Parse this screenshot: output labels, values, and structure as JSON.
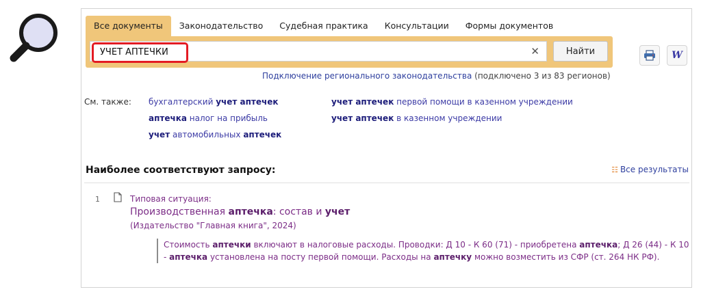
{
  "tabs": [
    "Все документы",
    "Законодательство",
    "Судебная практика",
    "Консультации",
    "Формы документов"
  ],
  "search": {
    "value": "УЧЕТ АПТЕЧКИ",
    "button": "Найти"
  },
  "regional": {
    "link": "Подключение регионального законодательства",
    "count": "(подключено 3 из 83 регионов)"
  },
  "see_also": {
    "label": "См. также:",
    "items": [
      {
        "pre": "бухгалтерский ",
        "bold": "учет аптечек",
        "post": ""
      },
      {
        "pre": "",
        "bold": "аптечка",
        "post": " налог на прибыль"
      },
      {
        "pre": "",
        "bold": "учет",
        "mid": " автомобильных ",
        "bold2": "аптечек"
      },
      {
        "pre": "",
        "bold": "учет аптечек",
        "post": " первой помощи в казенном учреждении"
      },
      {
        "pre": "",
        "bold": "учет аптечек",
        "post": " в казенном учреждении"
      }
    ]
  },
  "results_header": {
    "title": "Наиболее соответствуют запросу:",
    "all_results": "Все результаты"
  },
  "result": {
    "number": "1",
    "kind": "Типовая ситуация:",
    "title_part1": "Производственная ",
    "title_bold1": "аптечка",
    "title_part2": ": состав и ",
    "title_bold2": "учет",
    "source": "(Издательство \"Главная книга\", 2024)",
    "snippet": {
      "s1": "Стоимость ",
      "b1": "аптечки",
      "s2": " включают в налоговые расходы. Проводки: Д 10 - К 60 (71) - приобретена ",
      "b2": "аптечка",
      "s3": "; Д 26 (44) - К 10 - ",
      "b3": "аптечка",
      "s4": " установлена на посту первой помощи. Расходы на ",
      "b4": "аптечку",
      "s5": " можно возместить из СФР (ст. 264 НК РФ)."
    }
  },
  "colors": {
    "accent": "#f0c67a",
    "highlight": "#e31b23",
    "link": "#3b3aa5",
    "result": "#7b2c86"
  },
  "icons": [
    "magnifier-icon",
    "clear-icon",
    "print-icon",
    "word-icon",
    "results-list-icon",
    "document-icon"
  ]
}
